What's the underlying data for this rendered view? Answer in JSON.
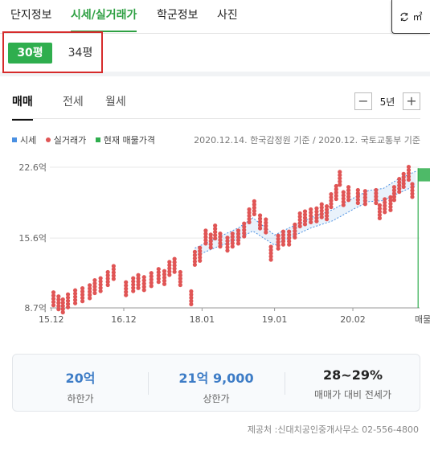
{
  "top_tabs": [
    "단지정보",
    "시세/실거래가",
    "학군정보",
    "사진"
  ],
  "unit_toggle": {
    "label": "㎡",
    "icon": "swap-icon"
  },
  "size_tabs": {
    "active": "30평",
    "other": "34평"
  },
  "deal_tabs": [
    "매매",
    "전세",
    "월세"
  ],
  "period": {
    "minus": "−",
    "value": "5년",
    "plus": "+"
  },
  "legend": [
    {
      "label": "시세",
      "color": "#4a90e2",
      "shape": "square"
    },
    {
      "label": "실거래가",
      "color": "#e05555",
      "shape": "dot"
    },
    {
      "label": "현재 매물가격",
      "color": "#2fae4e",
      "shape": "square"
    }
  ],
  "source_dates": "2020.12.14. 한국감정원 기준 / 2020.12. 국토교통부 기준",
  "chart_data": {
    "type": "scatter",
    "y_ticks": [
      "22.6억",
      "15.6억",
      "8.7억"
    ],
    "y_tick_values": [
      22.6,
      15.6,
      8.7
    ],
    "x_ticks": [
      "15.12",
      "16.12",
      "18.01",
      "19.01",
      "20.02"
    ],
    "x_tick_values": [
      2015.92,
      2016.92,
      2018.0,
      2019.0,
      2020.08
    ],
    "current_listing_label": "매물가격",
    "ylim": [
      8.7,
      22.6
    ],
    "xlim": [
      2015.9,
      2021.0
    ],
    "series": [
      {
        "name": "시세",
        "color": "#4a90e2",
        "band_x": [
          2017.9,
          2018.2,
          2018.5,
          2018.7,
          2019.0,
          2019.2,
          2019.5,
          2019.8,
          2020.1,
          2020.3,
          2020.5,
          2020.7,
          2020.95
        ],
        "band_low": [
          13.8,
          14.7,
          15.5,
          16.3,
          14.9,
          15.6,
          16.6,
          17.3,
          18.5,
          19.2,
          19.3,
          20.0,
          20.8
        ],
        "band_high": [
          14.6,
          15.6,
          16.6,
          17.6,
          15.9,
          16.6,
          17.6,
          18.4,
          19.6,
          20.3,
          20.5,
          21.4,
          22.2
        ]
      },
      {
        "name": "실거래가",
        "color": "#e05555",
        "points": [
          [
            2015.95,
            9.6
          ],
          [
            2016.02,
            9.2
          ],
          [
            2016.08,
            8.9
          ],
          [
            2016.15,
            9.4
          ],
          [
            2016.25,
            9.8
          ],
          [
            2016.35,
            10.0
          ],
          [
            2016.45,
            10.3
          ],
          [
            2016.52,
            10.8
          ],
          [
            2016.6,
            11.0
          ],
          [
            2016.7,
            11.6
          ],
          [
            2016.78,
            12.2
          ],
          [
            2016.95,
            10.6
          ],
          [
            2017.05,
            11.0
          ],
          [
            2017.12,
            11.3
          ],
          [
            2017.2,
            11.1
          ],
          [
            2017.3,
            11.5
          ],
          [
            2017.4,
            11.9
          ],
          [
            2017.48,
            11.7
          ],
          [
            2017.55,
            12.6
          ],
          [
            2017.62,
            12.9
          ],
          [
            2017.7,
            11.6
          ],
          [
            2017.85,
            9.7
          ],
          [
            2017.9,
            13.6
          ],
          [
            2017.97,
            14.0
          ],
          [
            2018.05,
            15.7
          ],
          [
            2018.12,
            15.3
          ],
          [
            2018.18,
            16.2
          ],
          [
            2018.25,
            15.4
          ],
          [
            2018.35,
            15.0
          ],
          [
            2018.42,
            15.4
          ],
          [
            2018.5,
            15.7
          ],
          [
            2018.58,
            16.4
          ],
          [
            2018.65,
            17.8
          ],
          [
            2018.72,
            18.6
          ],
          [
            2018.8,
            17.2
          ],
          [
            2018.88,
            16.8
          ],
          [
            2018.95,
            14.1
          ],
          [
            2019.05,
            15.2
          ],
          [
            2019.12,
            15.6
          ],
          [
            2019.2,
            15.6
          ],
          [
            2019.28,
            16.3
          ],
          [
            2019.35,
            17.4
          ],
          [
            2019.42,
            17.6
          ],
          [
            2019.5,
            17.8
          ],
          [
            2019.58,
            17.9
          ],
          [
            2019.65,
            18.3
          ],
          [
            2019.72,
            18.1
          ],
          [
            2019.78,
            19.3
          ],
          [
            2019.85,
            20.1
          ],
          [
            2019.9,
            21.5
          ],
          [
            2019.95,
            19.5
          ],
          [
            2020.02,
            20.0
          ],
          [
            2020.15,
            19.7
          ],
          [
            2020.25,
            19.6
          ],
          [
            2020.4,
            19.7
          ],
          [
            2020.45,
            18.2
          ],
          [
            2020.52,
            18.8
          ],
          [
            2020.6,
            19.0
          ],
          [
            2020.65,
            20.0
          ],
          [
            2020.72,
            20.8
          ],
          [
            2020.78,
            21.3
          ],
          [
            2020.85,
            22.0
          ],
          [
            2020.9,
            20.3
          ]
        ]
      },
      {
        "name": "현재 매물가격",
        "color": "#2fae4e",
        "range": [
          21.2,
          22.5
        ]
      }
    ]
  },
  "summary": {
    "low": {
      "value": "20억",
      "label": "하한가"
    },
    "high": {
      "value": "21억 9,000",
      "label": "상한가"
    },
    "ratio": {
      "value": "28~29%",
      "label": "매매가 대비 전세가"
    }
  },
  "provider": "제공처 :신대치공인중개사무소 02-556-4800"
}
